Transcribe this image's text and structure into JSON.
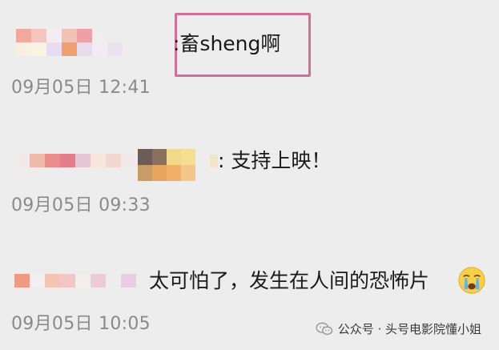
{
  "comments": [
    {
      "text": ":畜sheng啊",
      "timestamp": "09月05日 12:41",
      "highlighted": true
    },
    {
      "text": ": 支持上映！",
      "timestamp": "09月05日 09:33",
      "highlighted": false
    },
    {
      "text": "太可怕了，发生在人间的恐怖片",
      "timestamp": "09月05日 10:05",
      "highlighted": false,
      "emoji": "crying-face-icon"
    }
  ],
  "watermark": {
    "icon": "wechat-icon",
    "text": "公众号 · 头号电影院懂小姐"
  },
  "colors": {
    "background": "#ededed",
    "highlight_border": "#d06f9a",
    "timestamp": "#8a8a8a",
    "text": "#1a1a1a"
  }
}
